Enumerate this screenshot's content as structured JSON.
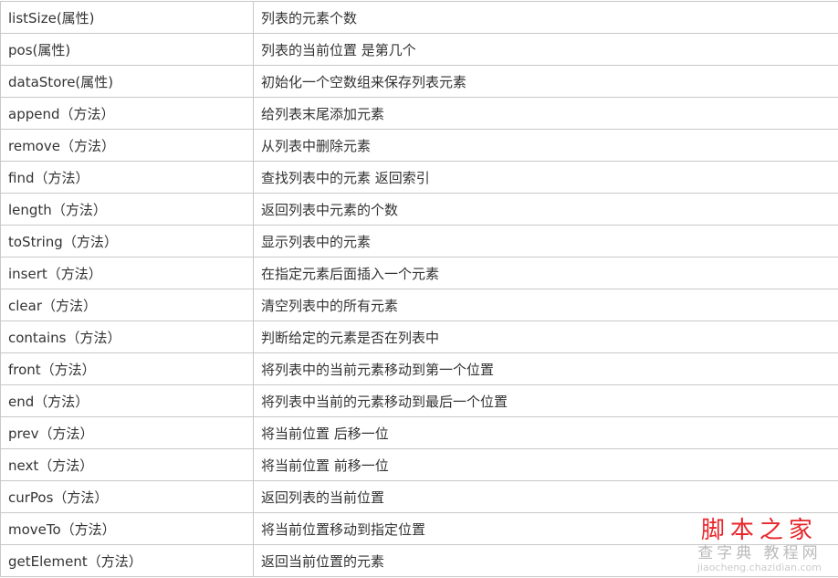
{
  "rows": [
    {
      "name": "listSize(属性)",
      "desc": "列表的元素个数"
    },
    {
      "name": "pos(属性)",
      "desc": "列表的当前位置 是第几个"
    },
    {
      "name": "dataStore(属性)",
      "desc": "初始化一个空数组来保存列表元素"
    },
    {
      "name": "append（方法）",
      "desc": "给列表末尾添加元素"
    },
    {
      "name": "remove（方法）",
      "desc": "从列表中删除元素"
    },
    {
      "name": "find（方法）",
      "desc": "查找列表中的元素 返回索引"
    },
    {
      "name": "length（方法）",
      "desc": "返回列表中元素的个数"
    },
    {
      "name": "toString（方法）",
      "desc": "显示列表中的元素"
    },
    {
      "name": "insert（方法）",
      "desc": "在指定元素后面插入一个元素"
    },
    {
      "name": "clear（方法）",
      "desc": "清空列表中的所有元素"
    },
    {
      "name": "contains（方法）",
      "desc": "判断给定的元素是否在列表中"
    },
    {
      "name": "front（方法）",
      "desc": "将列表中的当前元素移动到第一个位置"
    },
    {
      "name": "end（方法）",
      "desc": "将列表中当前的元素移动到最后一个位置"
    },
    {
      "name": "prev（方法）",
      "desc": "将当前位置 后移一位"
    },
    {
      "name": "next（方法）",
      "desc": "将当前位置 前移一位"
    },
    {
      "name": "curPos（方法）",
      "desc": "返回列表的当前位置"
    },
    {
      "name": "moveTo（方法）",
      "desc": "将当前位置移动到指定位置"
    },
    {
      "name": "getElement（方法）",
      "desc": "返回当前位置的元素"
    }
  ],
  "watermark": {
    "brand": "脚本之家",
    "sub": "查字典 教程网",
    "url": "jiaocheng.chazidian.com",
    "color": "#e8262b"
  }
}
